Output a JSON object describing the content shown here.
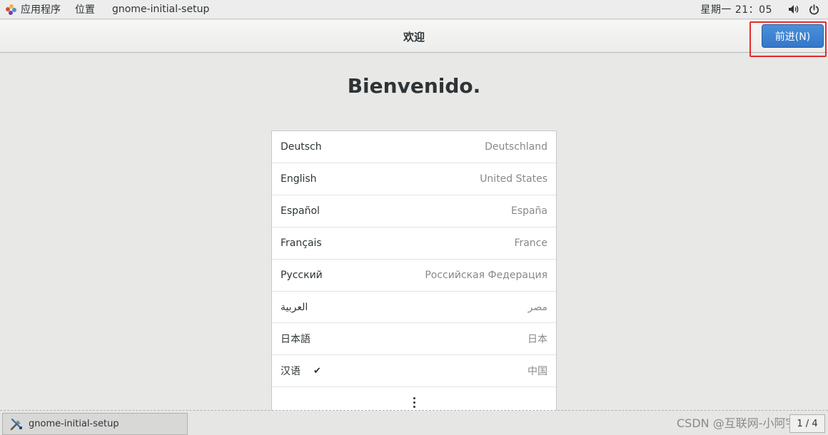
{
  "top_panel": {
    "apps_label": "应用程序",
    "places_label": "位置",
    "app_name": "gnome-initial-setup",
    "clock": "星期一 21：05",
    "icons": {
      "apps": "gnome-foot-icon",
      "volume": "volume-icon",
      "power": "power-icon"
    }
  },
  "header": {
    "title": "欢迎",
    "next_label": "前进(N)"
  },
  "main": {
    "welcome_text": "Bienvenido.",
    "languages": [
      {
        "name": "Deutsch",
        "region": "Deutschland",
        "selected": false
      },
      {
        "name": "English",
        "region": "United States",
        "selected": false
      },
      {
        "name": "Español",
        "region": "España",
        "selected": false
      },
      {
        "name": "Français",
        "region": "France",
        "selected": false
      },
      {
        "name": "Русский",
        "region": "Российская Федерация",
        "selected": false
      },
      {
        "name": "العربية",
        "region": "مصر",
        "selected": false
      },
      {
        "name": "日本語",
        "region": "日本",
        "selected": false
      },
      {
        "name": "汉语",
        "region": "中国",
        "selected": true
      }
    ],
    "check_mark": "✔"
  },
  "bottom_panel": {
    "task_label": "gnome-initial-setup",
    "pager": "1 / 4",
    "watermark": "CSDN @互联网-小阿宇"
  },
  "colors": {
    "accent": "#3577c9",
    "highlight_box": "#e52b2b",
    "background": "#e8e8e7"
  }
}
